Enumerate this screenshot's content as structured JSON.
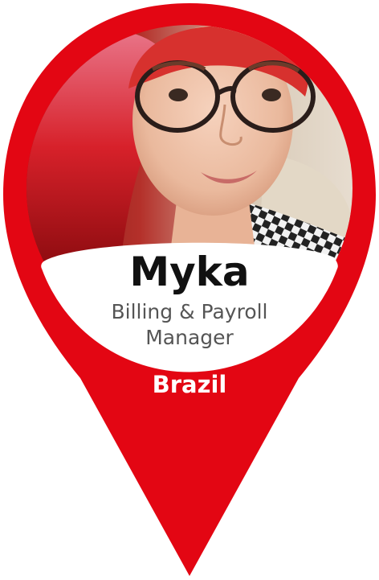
{
  "profile": {
    "name": "Myka",
    "role_line1": "Billing & Payroll",
    "role_line2": "Manager",
    "country": "Brazil"
  },
  "colors": {
    "pin_red": "#e30613",
    "pin_shade": "#c1000c",
    "label_bg": "#ffffff",
    "name_text": "#111111",
    "role_text": "#555555",
    "country_text": "#ffffff"
  },
  "icons": {
    "marker": "map-pin-icon"
  }
}
